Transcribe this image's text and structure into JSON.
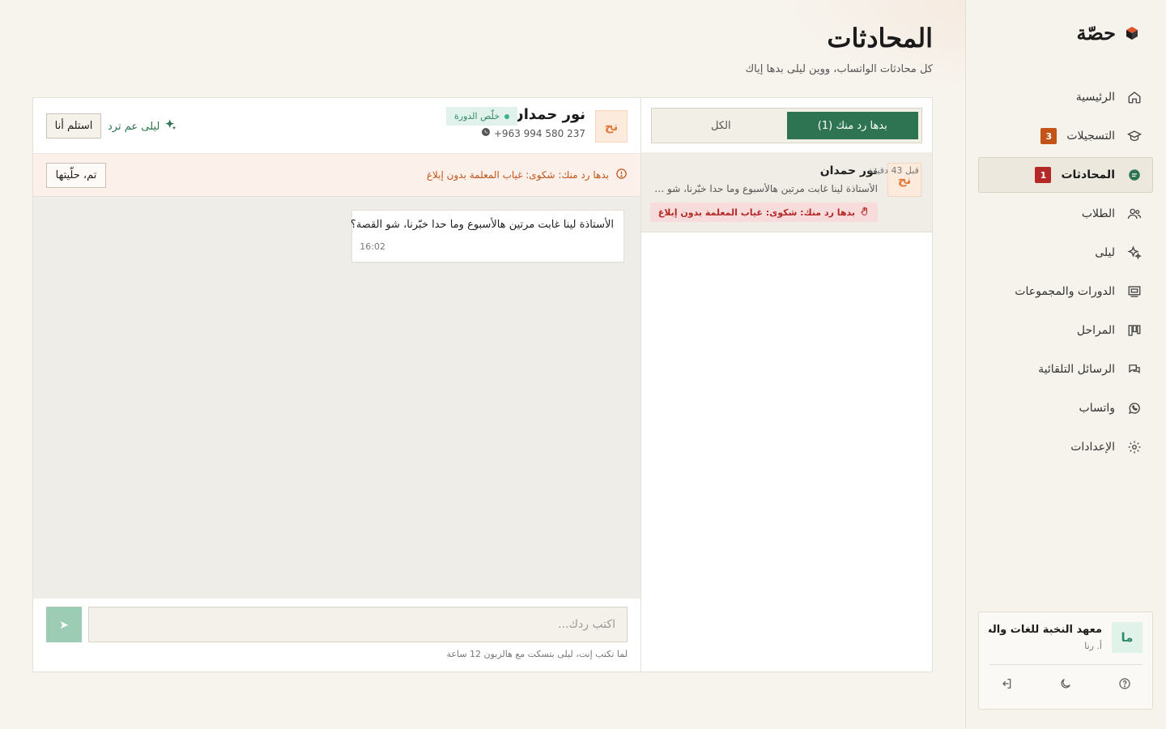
{
  "brand": {
    "name": "حصّة"
  },
  "nav": {
    "items": [
      {
        "key": "home",
        "label": "الرئيسية",
        "icon": "home-icon",
        "badge": "",
        "active": false
      },
      {
        "key": "registrations",
        "label": "التسجيلات",
        "icon": "graduation-cap-icon",
        "badge": "3",
        "badge_color": "#c2541a",
        "active": false
      },
      {
        "key": "conversations",
        "label": "المحادثات",
        "icon": "chat-bubble-icon",
        "badge": "1",
        "badge_color": "#b42828",
        "active": true
      },
      {
        "key": "students",
        "label": "الطلاب",
        "icon": "users-icon",
        "badge": "",
        "active": false
      },
      {
        "key": "laila",
        "label": "ليلى",
        "icon": "sparkles-icon",
        "badge": "",
        "active": false
      },
      {
        "key": "courses",
        "label": "الدورات والمجموعات",
        "icon": "presentation-board-icon",
        "badge": "",
        "active": false
      },
      {
        "key": "stages",
        "label": "المراحل",
        "icon": "kanban-icon",
        "badge": "",
        "active": false
      },
      {
        "key": "auto_messages",
        "label": "الرسائل التلقائية",
        "icon": "chat-bubbles-icon",
        "badge": "",
        "active": false
      },
      {
        "key": "whatsapp",
        "label": "واتساب",
        "icon": "whatsapp-icon",
        "badge": "",
        "active": false
      },
      {
        "key": "settings",
        "label": "الإعدادات",
        "icon": "gear-icon",
        "badge": "",
        "active": false
      }
    ]
  },
  "org": {
    "avatar": "ما",
    "name": "معهد النخبة للغات والت...",
    "user": "أ. رنا"
  },
  "header": {
    "title": "المحادثات",
    "subtitle": "كل محادثات الواتساب، ووين ليلى بدها إياك"
  },
  "tabs": [
    {
      "label": "بدها رد منك (1)",
      "active": true
    },
    {
      "label": "الكل",
      "active": false
    }
  ],
  "conversations": [
    {
      "avatar": "نح",
      "name": "نور حمدان",
      "time": "قبل 43 دقيقة",
      "preview": "الأستاذة لينا غابت مرتين هالأسبوع وما حدا خبّرنا، شو القصة؟",
      "alert": "بدها رد منك: شكوى: غياب المعلمة بدون إبلاغ"
    }
  ],
  "chat": {
    "avatar": "نح",
    "name": "نور حمدان",
    "status": "خلّص الدورة",
    "phone": "+963 994 580 237",
    "laila_status": "ليلى عم ترد",
    "take_over_label": "استلم أنا",
    "alert_text": "بدها رد منك: شكوى: غياب المعلمة بدون إبلاغ",
    "resolve_label": "تم، حلّيتها",
    "messages": [
      {
        "text": "الأستاذة لينا غابت مرتين هالأسبوع وما حدا خبّرنا، شو القصة؟",
        "time": "16:02"
      }
    ],
    "reply_placeholder": "اكتب ردك...",
    "send_label": "➤",
    "composer_hint": "لما تكتب إنت، ليلى بتسكت مع هالزبون 12 ساعة"
  },
  "colors": {
    "accent": "#2f7452",
    "danger": "#b42828",
    "warning": "#c0541a",
    "background": "#f7f4ee"
  }
}
